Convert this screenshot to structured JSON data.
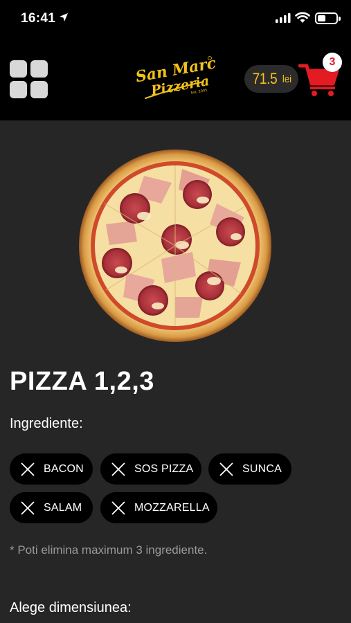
{
  "status_bar": {
    "time": "16:41"
  },
  "header": {
    "logo_text_1": "San Marco",
    "logo_text_2": "Pizzeria",
    "logo_small": "Est. 2005",
    "cart_total_value": "71.5",
    "cart_total_unit": "lei",
    "cart_count": "3"
  },
  "product": {
    "title": "PIZZA 1,2,3",
    "ingredients_label": "Ingrediente:",
    "ingredients": [
      {
        "name": "BACON"
      },
      {
        "name": "SOS PIZZA"
      },
      {
        "name": "SUNCA"
      },
      {
        "name": "SALAM"
      },
      {
        "name": "MOZZARELLA"
      }
    ],
    "note": "* Poti elimina maximum 3 ingrediente.",
    "size_label": "Alege dimensiunea:"
  },
  "colors": {
    "accent_yellow": "#f2c21a",
    "cart_red": "#e31b23",
    "background": "#262626",
    "header": "#000000"
  }
}
